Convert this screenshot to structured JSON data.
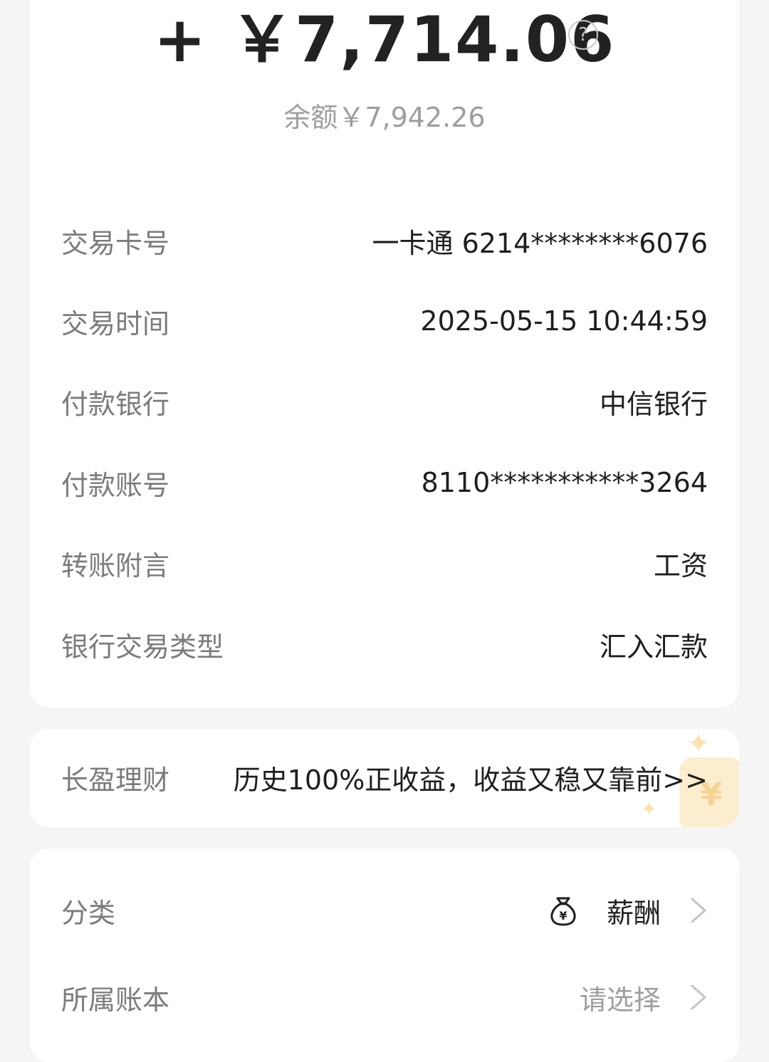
{
  "summary": {
    "amount": "+ ￥7,714.06",
    "balance": "余额￥7,942.26",
    "help_icon": "question-circle-icon"
  },
  "details": [
    {
      "label": "交易卡号",
      "value": "一卡通 6214********6076"
    },
    {
      "label": "交易时间",
      "value": "2025-05-15 10:44:59"
    },
    {
      "label": "付款银行",
      "value": "中信银行"
    },
    {
      "label": "付款账号",
      "value": "8110***********3264"
    },
    {
      "label": "转账附言",
      "value": "工资"
    },
    {
      "label": "银行交易类型",
      "value": "汇入汇款"
    }
  ],
  "promo": {
    "label": "长盈理财",
    "text": "历史100%正收益，收益又稳又靠前>>",
    "decoration_icon": "yuan-coin-icon"
  },
  "settings": {
    "category": {
      "label": "分类",
      "value": "薪酬",
      "icon": "money-bag-icon"
    },
    "ledger": {
      "label": "所属账本",
      "value": "请选择"
    }
  },
  "colors": {
    "background": "#f5f5f5",
    "card": "#ffffff",
    "label": "#7b7b7b",
    "value": "#1e1e1e",
    "muted": "#9e9e9e"
  }
}
